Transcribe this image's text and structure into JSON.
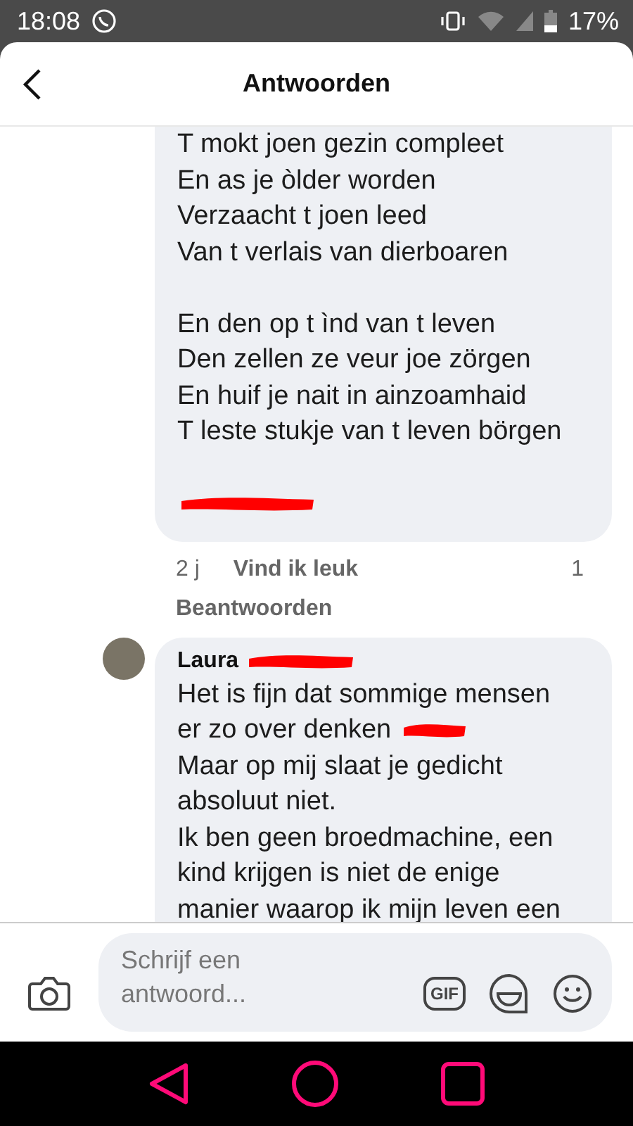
{
  "status_bar": {
    "time": "18:08",
    "battery": "17%"
  },
  "header": {
    "title": "Antwoorden"
  },
  "comments": [
    {
      "lines": [
        {
          "kind": "text",
          "text": "T mokt joen gezin compleet",
          "redacted": false
        },
        {
          "kind": "text",
          "text": "En as je òlder worden",
          "redacted": false
        },
        {
          "kind": "text",
          "text": "Verzaacht t joen leed",
          "redacted": false
        },
        {
          "kind": "text",
          "text": "Van t verlais van dierboaren",
          "redacted": false
        },
        {
          "kind": "blank"
        },
        {
          "kind": "text",
          "text": "En den op t ìnd van t leven",
          "redacted": false
        },
        {
          "kind": "text",
          "text": "Den zellen ze veur joe zörgen",
          "redacted": false
        },
        {
          "kind": "text",
          "text": "En huif je nait in ainzoamhaid",
          "redacted": false
        },
        {
          "kind": "text",
          "text": "T leste stukje van t leven börgen",
          "redacted": false
        },
        {
          "kind": "blank"
        },
        {
          "kind": "redaction"
        }
      ],
      "age": "2 j",
      "like": "Vind ik leuk",
      "like_count": "1",
      "reply": "Beantwoorden"
    },
    {
      "author": "Laura",
      "author_redacted": true,
      "lines": [
        {
          "kind": "text",
          "text": "Het is fijn dat sommige mensen",
          "redacted": false
        },
        {
          "kind": "text",
          "text": "er zo over denken",
          "redacted": true
        },
        {
          "kind": "text",
          "text": "Maar op mij slaat je gedicht",
          "redacted": false
        },
        {
          "kind": "text",
          "text": "absoluut niet.",
          "redacted": false
        },
        {
          "kind": "text",
          "text": "Ik ben geen broedmachine, een",
          "redacted": false
        },
        {
          "kind": "text",
          "text": "kind krijgen is niet de enige",
          "redacted": false
        },
        {
          "kind": "text",
          "text": "manier waarop ik mijn leven een",
          "redacted": false
        }
      ]
    }
  ],
  "composer": {
    "placeholder": "Schrijf een antwoord...",
    "gif_label": "GIF"
  }
}
